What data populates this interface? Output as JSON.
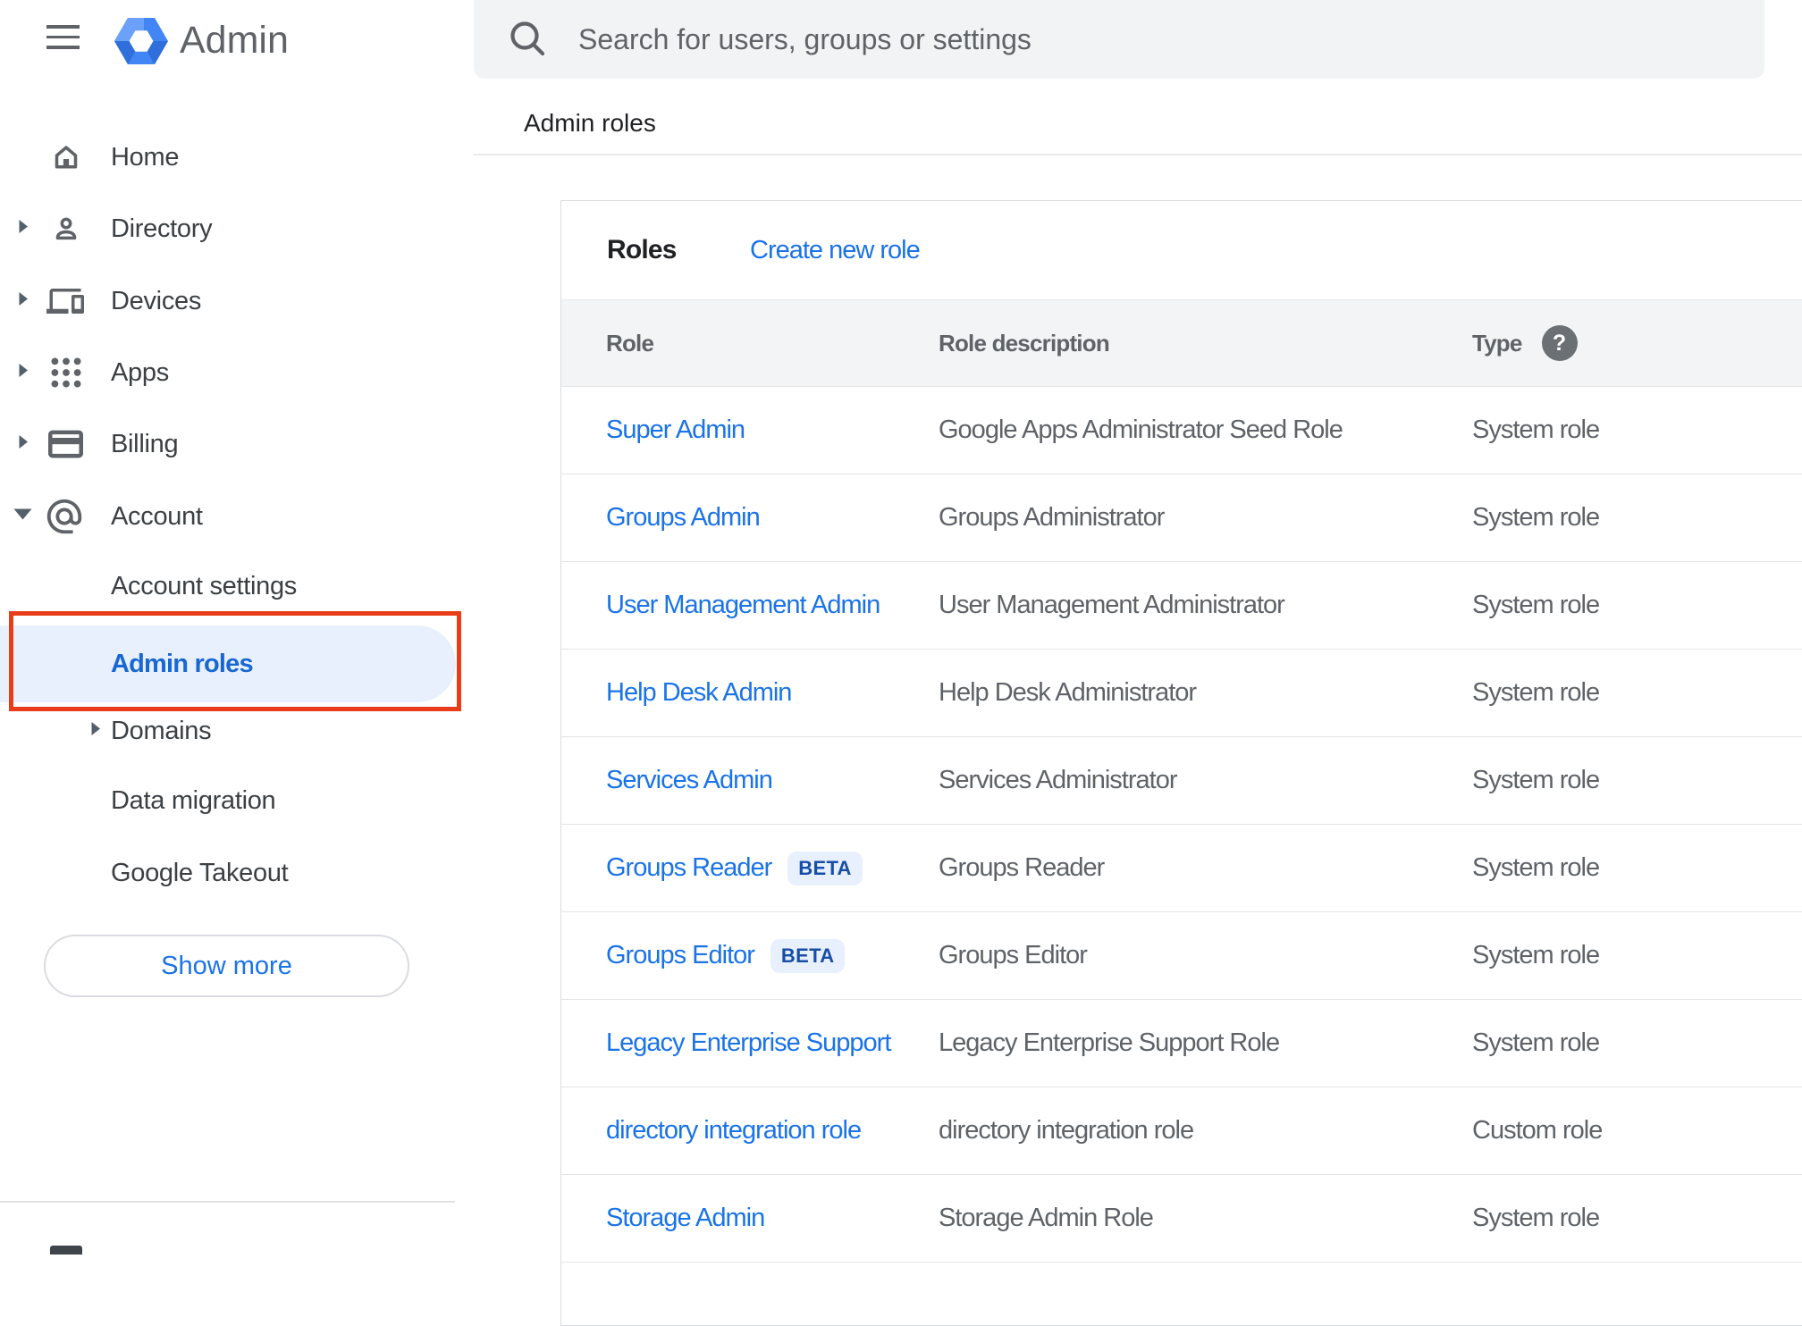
{
  "header": {
    "app_name": "Admin",
    "search": {
      "placeholder": "Search for users, groups or settings"
    },
    "breadcrumb": "Admin roles"
  },
  "sidebar": {
    "items": [
      {
        "id": "home",
        "label": "Home",
        "icon": "home-icon",
        "arrow": "none"
      },
      {
        "id": "directory",
        "label": "Directory",
        "icon": "person-icon",
        "arrow": "collapsed"
      },
      {
        "id": "devices",
        "label": "Devices",
        "icon": "devices-icon",
        "arrow": "collapsed"
      },
      {
        "id": "apps",
        "label": "Apps",
        "icon": "apps-icon",
        "arrow": "collapsed"
      },
      {
        "id": "billing",
        "label": "Billing",
        "icon": "billing-icon",
        "arrow": "collapsed"
      },
      {
        "id": "account",
        "label": "Account",
        "icon": "at-icon",
        "arrow": "expanded"
      }
    ],
    "sub_items": [
      {
        "id": "account-settings",
        "label": "Account settings",
        "arrow": "none",
        "selected": false
      },
      {
        "id": "admin-roles",
        "label": "Admin roles",
        "arrow": "none",
        "selected": true,
        "annotated": true
      },
      {
        "id": "domains",
        "label": "Domains",
        "arrow": "collapsed",
        "selected": false
      },
      {
        "id": "data-migration",
        "label": "Data migration",
        "arrow": "none",
        "selected": false
      },
      {
        "id": "google-takeout",
        "label": "Google Takeout",
        "arrow": "none",
        "selected": false
      }
    ],
    "show_more_label": "Show more"
  },
  "main": {
    "card": {
      "title": "Roles",
      "create_link": "Create new role",
      "table": {
        "columns": [
          "Role",
          "Role description",
          "Type"
        ],
        "help_icon": "?",
        "rows": [
          {
            "role": "Super Admin",
            "beta": false,
            "description": "Google Apps Administrator Seed Role",
            "type": "System role"
          },
          {
            "role": "Groups Admin",
            "beta": false,
            "description": "Groups Administrator",
            "type": "System role"
          },
          {
            "role": "User Management Admin",
            "beta": false,
            "description": "User Management Administrator",
            "type": "System role"
          },
          {
            "role": "Help Desk Admin",
            "beta": false,
            "description": "Help Desk Administrator",
            "type": "System role"
          },
          {
            "role": "Services Admin",
            "beta": false,
            "description": "Services Administrator",
            "type": "System role"
          },
          {
            "role": "Groups Reader",
            "beta": true,
            "beta_label": "BETA",
            "description": "Groups Reader",
            "type": "System role"
          },
          {
            "role": "Groups Editor",
            "beta": true,
            "beta_label": "BETA",
            "description": "Groups Editor",
            "type": "System role"
          },
          {
            "role": "Legacy Enterprise Support",
            "beta": false,
            "description": "Legacy Enterprise Support Role",
            "type": "System role"
          },
          {
            "role": "directory integration role",
            "beta": false,
            "description": "directory integration role",
            "type": "Custom role"
          },
          {
            "role": "Storage Admin",
            "beta": false,
            "description": "Storage Admin Role",
            "type": "System role"
          }
        ]
      }
    }
  },
  "colors": {
    "link_blue": "#1a73e8",
    "text_dark": "#202124",
    "text_gray": "#5f6368",
    "sidebar_text": "#3c4043",
    "icon_gray": "#5f6368",
    "divider": "#e4e4e4",
    "card_border": "#dadce0",
    "thead_bg": "#f3f4f5",
    "search_bg": "#f1f3f4",
    "pill_bg": "#e8f0fe",
    "beta_bg": "#e8f0fe",
    "beta_text": "#174ea6",
    "selected_text": "#1967d2",
    "annotation_red": "#e93d19",
    "button_border": "#dadce0",
    "logo_blue": "#4285f4",
    "logo_blue_light": "#6ba1f8",
    "logo_blue_dark": "#2f6fdc"
  }
}
